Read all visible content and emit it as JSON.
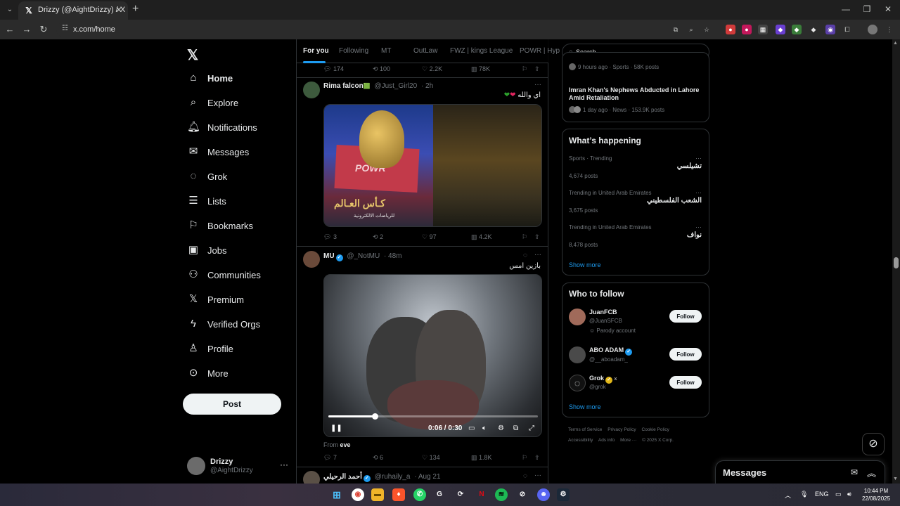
{
  "browser": {
    "tab_title": "Drizzy (@AightDrizzy) / X",
    "url": "x.com/home"
  },
  "nav": {
    "items": [
      {
        "label": "Home",
        "icon": "home-icon"
      },
      {
        "label": "Explore",
        "icon": "search-icon"
      },
      {
        "label": "Notifications",
        "icon": "bell-icon"
      },
      {
        "label": "Messages",
        "icon": "envelope-icon"
      },
      {
        "label": "Grok",
        "icon": "grok-icon"
      },
      {
        "label": "Lists",
        "icon": "list-icon"
      },
      {
        "label": "Bookmarks",
        "icon": "bookmark-icon"
      },
      {
        "label": "Jobs",
        "icon": "briefcase-icon"
      },
      {
        "label": "Communities",
        "icon": "people-icon"
      },
      {
        "label": "Premium",
        "icon": "x-icon"
      },
      {
        "label": "Verified Orgs",
        "icon": "lightning-icon"
      },
      {
        "label": "Profile",
        "icon": "person-icon"
      },
      {
        "label": "More",
        "icon": "more-circle-icon"
      }
    ],
    "post_label": "Post",
    "account": {
      "name": "Drizzy",
      "handle": "@AightDrizzy"
    }
  },
  "feed": {
    "tabs": [
      "For you",
      "Following",
      "MT",
      "OutLaw",
      "FWZ | kings League",
      "POWR | Hyp"
    ],
    "top_actions": {
      "replies": "174",
      "reposts": "100",
      "likes": "2.2K",
      "views": "78K"
    },
    "tweets": [
      {
        "name": "Rima falcon",
        "handle": "@Just_Girl20",
        "time": "· 2h",
        "text": "اي والله",
        "actions": {
          "replies": "3",
          "reposts": "2",
          "likes": "97",
          "views": "4.2K"
        },
        "media": {
          "flag_text": "POWR",
          "cup_text": "كـأس العـالم",
          "cup_sub": "للرياضات الالكترونية"
        }
      },
      {
        "name": "MU",
        "handle": "@_NotMU",
        "time": "· 48m",
        "text": "بازين امس",
        "video": {
          "time": "0:06 / 0:30"
        },
        "from_label": "From",
        "from_source": "eve",
        "actions": {
          "replies": "7",
          "reposts": "6",
          "likes": "134",
          "views": "1.8K"
        }
      },
      {
        "name": "أحمد الرحيلي",
        "handle": "@ruhaily_a",
        "time": "· Aug 21"
      }
    ]
  },
  "right": {
    "search_placeholder": "Search",
    "news": [
      {
        "meta": "9 hours ago · Sports · 58K posts"
      },
      {
        "title": "Imran Khan's Nephews Abducted in Lahore Amid Retaliation",
        "meta": "1 day ago · News · 153.9K posts"
      }
    ],
    "whats_happening": {
      "title": "What’s happening",
      "trends": [
        {
          "context": "Sports · Trending",
          "name": "تشيلسي",
          "count": "4,674 posts"
        },
        {
          "context": "Trending in United Arab Emirates",
          "name": "الشعب الفلسطيني",
          "count": "3,675 posts"
        },
        {
          "context": "Trending in United Arab Emirates",
          "name": "نواف",
          "count": "8,478 posts"
        }
      ],
      "show_more": "Show more"
    },
    "who_to_follow": {
      "title": "Who to follow",
      "people": [
        {
          "name": "JuanFCB",
          "handle": "@JuanSFCB",
          "extra": "Parody account",
          "follow": "Follow"
        },
        {
          "name": "ABO ADAM",
          "handle": "@__aboadam_",
          "follow": "Follow"
        },
        {
          "name": "Grok",
          "handle": "@grok",
          "follow": "Follow"
        }
      ],
      "show_more": "Show more"
    },
    "footer": [
      "Terms of Service",
      "Privacy Policy",
      "Cookie Policy",
      "Accessibility",
      "Ads info",
      "More ···",
      "© 2025 X Corp."
    ]
  },
  "messages_drawer": {
    "title": "Messages"
  },
  "taskbar": {
    "lang": "ENG",
    "time": "10:44 PM",
    "date": "22/08/2025"
  },
  "colors": {
    "accent": "#1d9bf0",
    "background": "#000000",
    "text": "#e7e9ea",
    "muted": "#71767b"
  }
}
